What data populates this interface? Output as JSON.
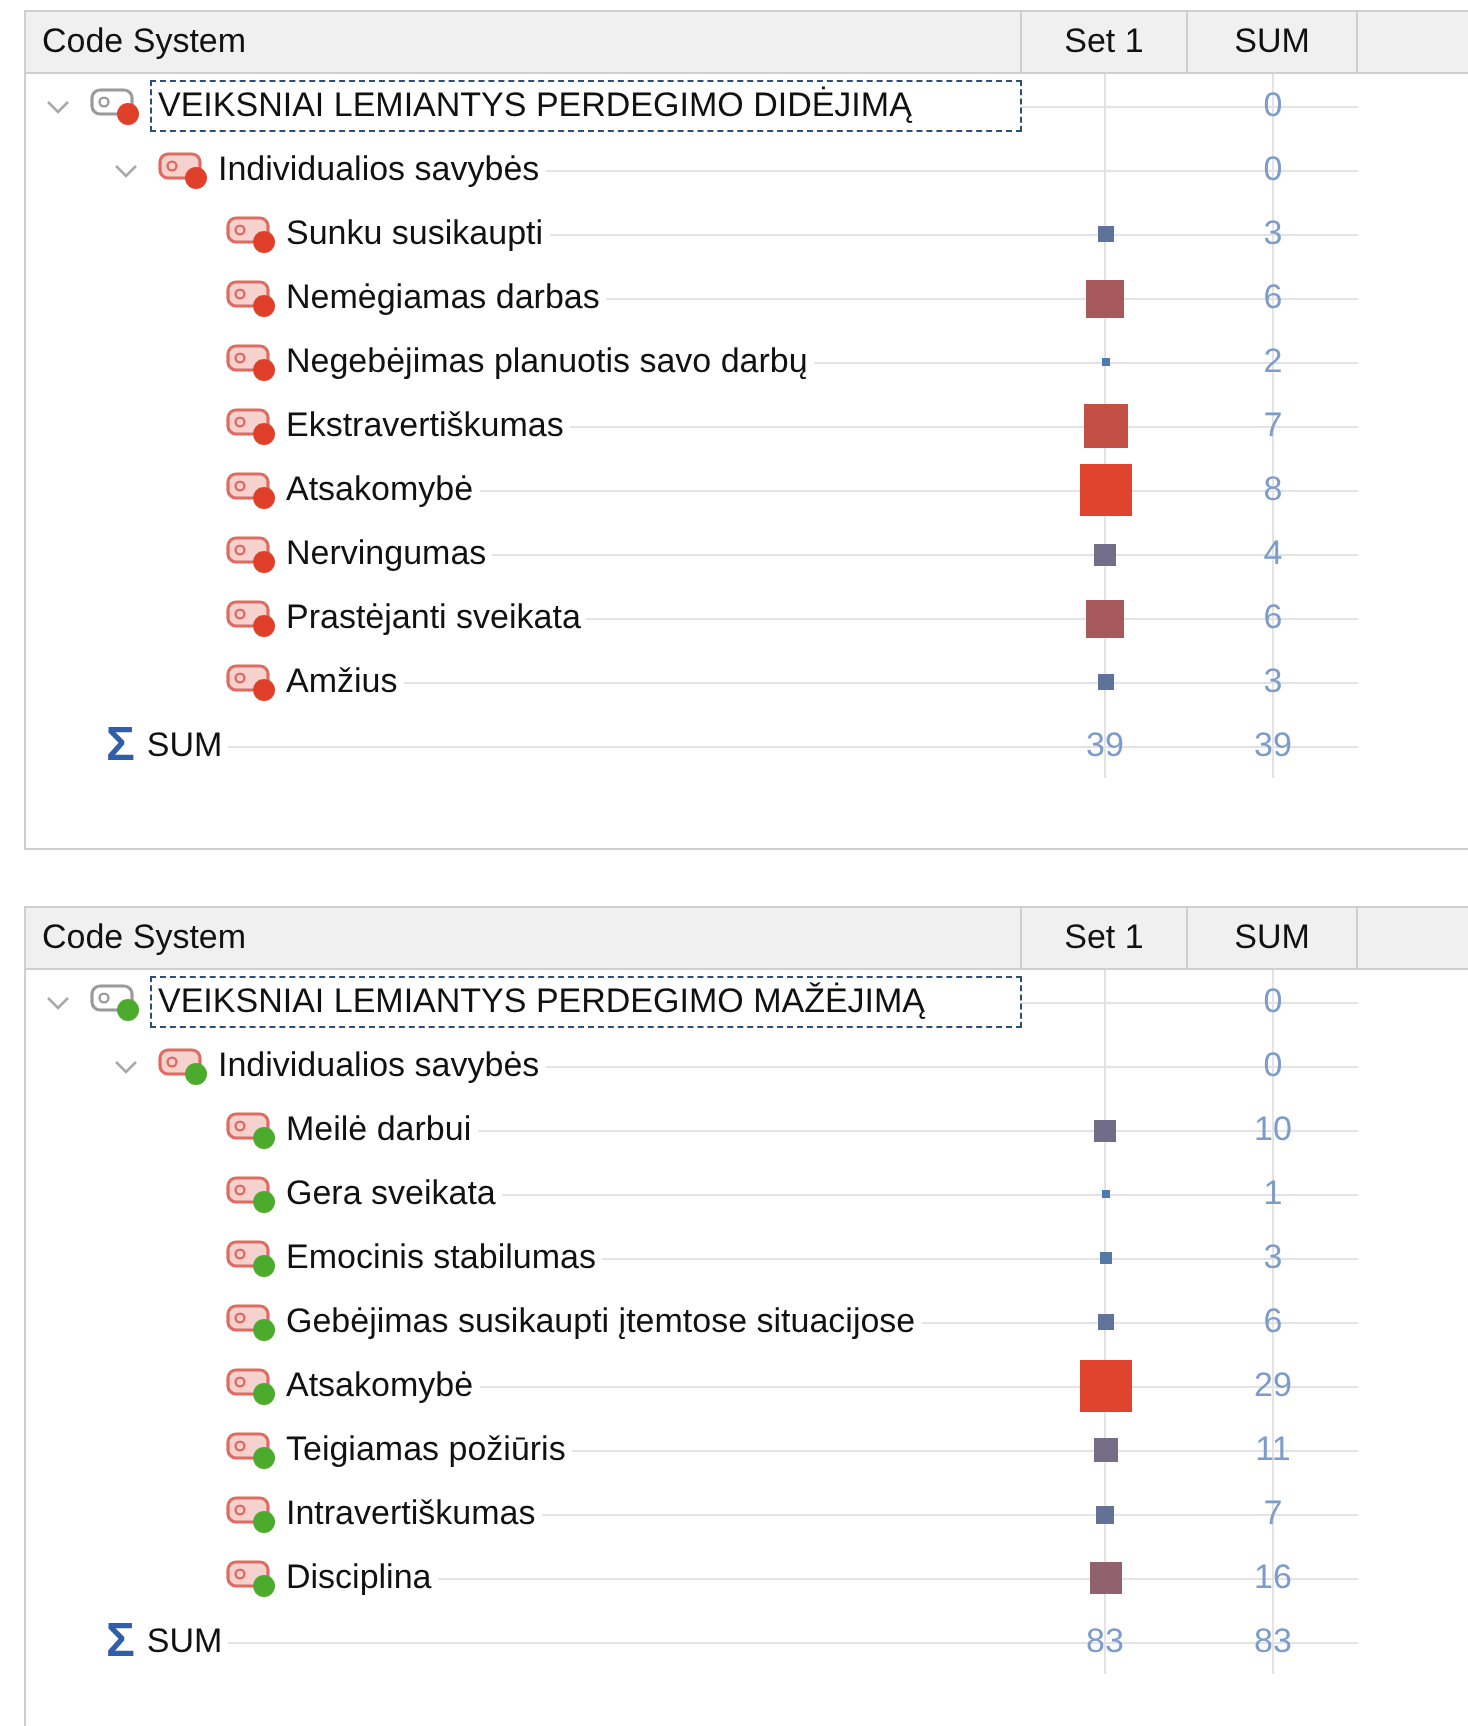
{
  "panels": [
    {
      "color": "#e0402a",
      "columns": [
        "Code System",
        "Set 1",
        "SUM"
      ],
      "root": {
        "label": "VEIKSNIAI LEMIANTYS PERDEGIMO DIDĖJIMĄ",
        "expanded": true,
        "selected": true,
        "sum": "0",
        "children": [
          {
            "label": "Individualios savybės",
            "expanded": true,
            "selected": false,
            "sum": "0",
            "children": [
              {
                "label": "Sunku susikaupti",
                "sum": "3"
              },
              {
                "label": "Nemėgiamas darbas",
                "sum": "6"
              },
              {
                "label": "Negebėjimas planuotis savo darbų",
                "sum": "2"
              },
              {
                "label": "Ekstravertiškumas",
                "sum": "7"
              },
              {
                "label": "Atsakomybė",
                "sum": "8"
              },
              {
                "label": "Nervingumas",
                "sum": "4"
              },
              {
                "label": "Prastėjanti sveikata",
                "sum": "6"
              },
              {
                "label": "Amžius",
                "sum": "3"
              }
            ]
          }
        ]
      },
      "total": {
        "symbol": "Σ",
        "label": "SUM",
        "set1": "39",
        "sum": "39"
      }
    },
    {
      "color": "#4caa2c",
      "columns": [
        "Code System",
        "Set 1",
        "SUM"
      ],
      "root": {
        "label": "VEIKSNIAI LEMIANTYS PERDEGIMO MAŽĖJIMĄ",
        "expanded": true,
        "selected": true,
        "sum": "0",
        "children": [
          {
            "label": "Individualios savybės",
            "expanded": true,
            "selected": false,
            "sum": "0",
            "children": [
              {
                "label": "Meilė darbui",
                "sum": "10"
              },
              {
                "label": "Gera sveikata",
                "sum": "1"
              },
              {
                "label": "Emocinis stabilumas",
                "sum": "3"
              },
              {
                "label": "Gebėjimas susikaupti įtemtose situacijose",
                "sum": "6"
              },
              {
                "label": "Atsakomybė",
                "sum": "29"
              },
              {
                "label": "Teigiamas požiūris",
                "sum": "11"
              },
              {
                "label": "Intravertiškumas",
                "sum": "7"
              },
              {
                "label": "Disciplina",
                "sum": "16"
              }
            ]
          }
        ]
      },
      "total": {
        "symbol": "Σ",
        "label": "SUM",
        "set1": "83",
        "sum": "83"
      }
    }
  ]
}
